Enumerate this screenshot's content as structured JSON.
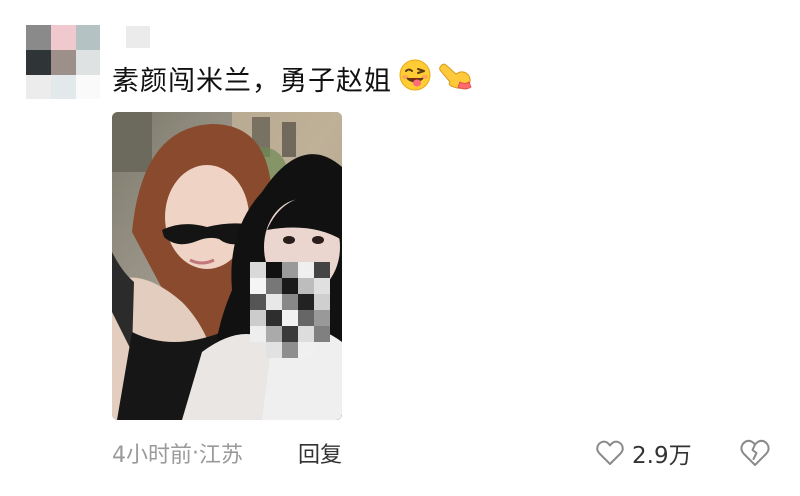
{
  "comment": {
    "text": "素颜闯米兰，勇子赵姐",
    "emojis": [
      "wink-tongue-emoji",
      "pointing-hand-emoji"
    ]
  },
  "meta": {
    "time": "4小时前",
    "separator": "·",
    "location": "江苏"
  },
  "actions": {
    "reply_label": "回复",
    "like_count": "2.9万"
  },
  "icons": {
    "like": "heart-outline-icon",
    "dislike": "broken-heart-icon"
  },
  "colors": {
    "meta_text": "#9a9a9a",
    "body_text": "#111111"
  }
}
